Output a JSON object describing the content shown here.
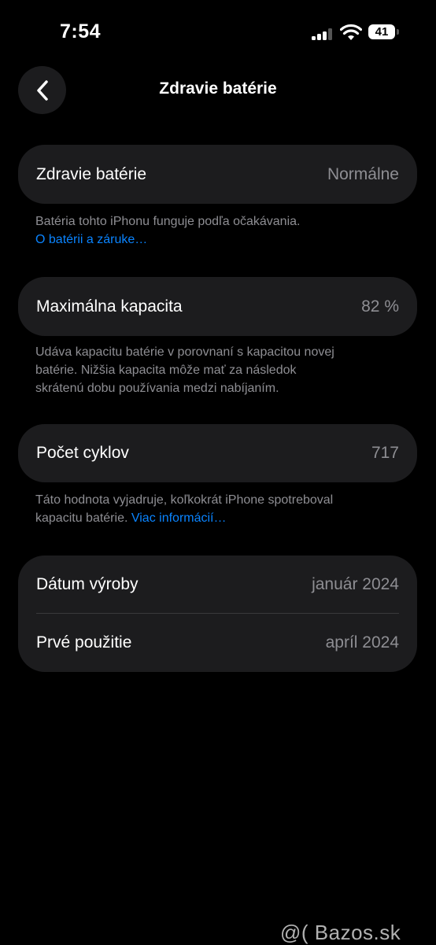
{
  "status_bar": {
    "time": "7:54",
    "battery_level": "41",
    "signal_bars_active": 3,
    "signal_bars_total": 4
  },
  "nav": {
    "back_icon": "chevron-left-icon",
    "title": "Zdravie batérie"
  },
  "health": {
    "label": "Zdravie batérie",
    "value": "Normálne",
    "footnote": "Batéria tohto iPhonu funguje podľa očakávania.",
    "link": "O batérii a záruke…"
  },
  "capacity": {
    "label": "Maximálna kapacita",
    "value": "82 %",
    "footnote_line1": "Udáva kapacitu batérie v porovnaní s kapacitou novej",
    "footnote_line2": "batérie. Nižšia kapacita môže mať za následok",
    "footnote_line3": "skrátenú dobu používania medzi nabíjaním."
  },
  "cycles": {
    "label": "Počet cyklov",
    "value": "717",
    "footnote_line1": "Táto hodnota vyjadruje, koľkokrát iPhone spotreboval",
    "footnote_line2": "kapacitu batérie.",
    "link": "Viac informácií…"
  },
  "dates": {
    "manufacture_label": "Dátum výroby",
    "manufacture_value": "január 2024",
    "first_use_label": "Prvé použitie",
    "first_use_value": "apríl 2024"
  },
  "watermark": "@( Bazos.sk",
  "colors": {
    "background": "#000000",
    "card": "#1c1c1e",
    "secondary_text": "#8e8e93",
    "link": "#0a84ff"
  }
}
